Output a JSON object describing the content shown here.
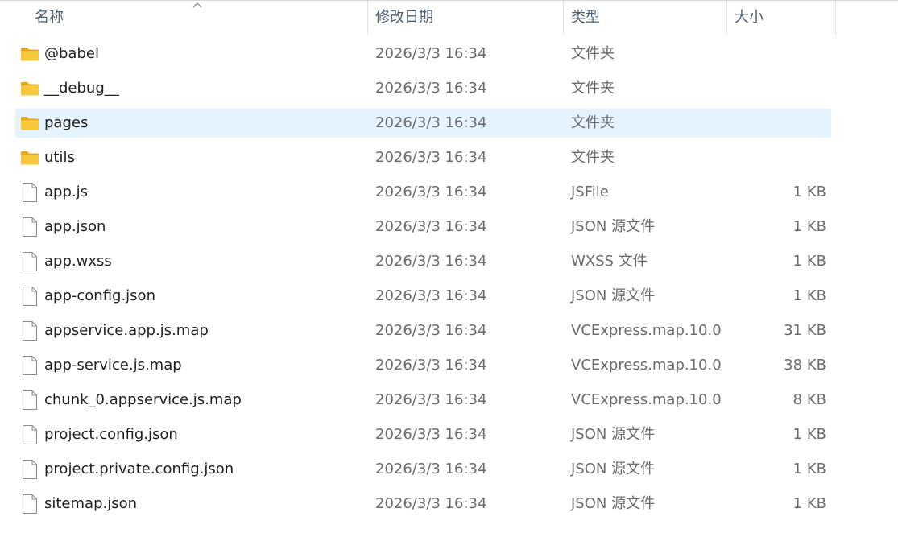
{
  "header": {
    "name": "名称",
    "date": "修改日期",
    "type": "类型",
    "size": "大小"
  },
  "colors": {
    "selected_row": "#e5f3ff",
    "folder_yellow": "#f8c83c",
    "header_text": "#4c5f73"
  },
  "rows": [
    {
      "name": "@babel",
      "date": "2026/3/3 16:34",
      "type": "文件夹",
      "size": "",
      "icon": "folder-icon"
    },
    {
      "name": "__debug__",
      "date": "2026/3/3 16:34",
      "type": "文件夹",
      "size": "",
      "icon": "folder-icon"
    },
    {
      "name": "pages",
      "date": "2026/3/3 16:34",
      "type": "文件夹",
      "size": "",
      "icon": "folder-icon",
      "selected": true
    },
    {
      "name": "utils",
      "date": "2026/3/3 16:34",
      "type": "文件夹",
      "size": "",
      "icon": "folder-icon"
    },
    {
      "name": "app.js",
      "date": "2026/3/3 16:34",
      "type": "JSFile",
      "size": "1 KB",
      "icon": "file-icon"
    },
    {
      "name": "app.json",
      "date": "2026/3/3 16:34",
      "type": "JSON 源文件",
      "size": "1 KB",
      "icon": "file-icon"
    },
    {
      "name": "app.wxss",
      "date": "2026/3/3 16:34",
      "type": "WXSS 文件",
      "size": "1 KB",
      "icon": "file-icon"
    },
    {
      "name": "app-config.json",
      "date": "2026/3/3 16:34",
      "type": "JSON 源文件",
      "size": "1 KB",
      "icon": "file-icon"
    },
    {
      "name": "appservice.app.js.map",
      "date": "2026/3/3 16:34",
      "type": "VCExpress.map.10.0",
      "size": "31 KB",
      "icon": "file-icon"
    },
    {
      "name": "app-service.js.map",
      "date": "2026/3/3 16:34",
      "type": "VCExpress.map.10.0",
      "size": "38 KB",
      "icon": "file-icon"
    },
    {
      "name": "chunk_0.appservice.js.map",
      "date": "2026/3/3 16:34",
      "type": "VCExpress.map.10.0",
      "size": "8 KB",
      "icon": "file-icon"
    },
    {
      "name": "project.config.json",
      "date": "2026/3/3 16:34",
      "type": "JSON 源文件",
      "size": "1 KB",
      "icon": "file-icon"
    },
    {
      "name": "project.private.config.json",
      "date": "2026/3/3 16:34",
      "type": "JSON 源文件",
      "size": "1 KB",
      "icon": "file-icon"
    },
    {
      "name": "sitemap.json",
      "date": "2026/3/3 16:34",
      "type": "JSON 源文件",
      "size": "1 KB",
      "icon": "file-icon"
    }
  ]
}
